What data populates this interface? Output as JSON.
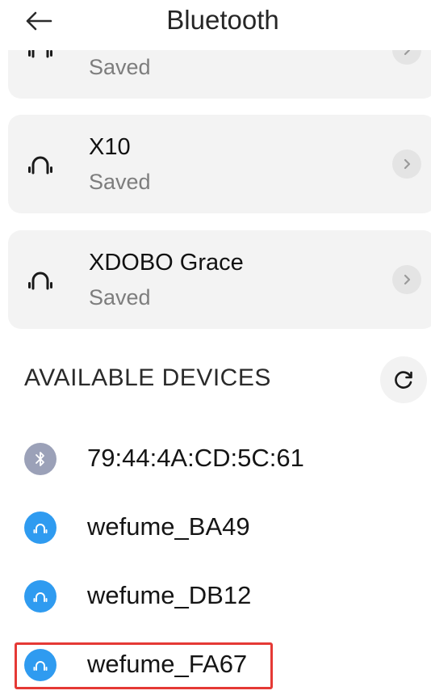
{
  "header": {
    "title": "Bluetooth",
    "back_icon": "arrow-left-icon"
  },
  "saved_devices": [
    {
      "name": "",
      "status": "Saved",
      "icon": "headphones-icon"
    },
    {
      "name": "X10",
      "status": "Saved",
      "icon": "headphones-icon"
    },
    {
      "name": "XDOBO Grace",
      "status": "Saved",
      "icon": "headphones-icon"
    }
  ],
  "available": {
    "title": "AVAILABLE DEVICES",
    "refresh_icon": "refresh-icon",
    "devices": [
      {
        "name": "79:44:4A:CD:5C:61",
        "icon": "bluetooth-icon",
        "icon_color": "#9ba1b8"
      },
      {
        "name": "wefume_BA49",
        "icon": "headphones-icon",
        "icon_color": "#2f9bf0"
      },
      {
        "name": "wefume_DB12",
        "icon": "headphones-icon",
        "icon_color": "#2f9bf0"
      },
      {
        "name": "wefume_FA67",
        "icon": "headphones-icon",
        "icon_color": "#2f9bf0"
      }
    ]
  },
  "colors": {
    "card_bg": "#f3f3f3",
    "highlight": "#e53935",
    "device_accent": "#2f9bf0"
  }
}
